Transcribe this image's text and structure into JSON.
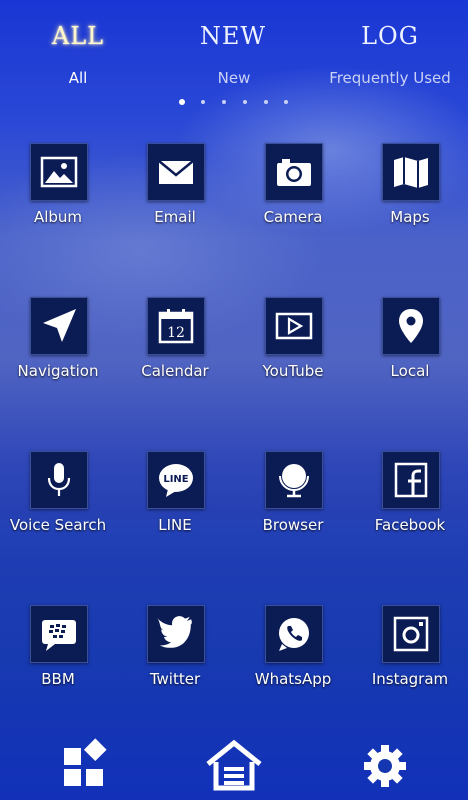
{
  "tabs": {
    "all": "ALL",
    "new": "NEW",
    "log": "LOG"
  },
  "subtabs": {
    "all": "All",
    "new": "New",
    "frequent": "Frequently Used"
  },
  "page_indicator": {
    "total": 6,
    "active": 1
  },
  "apps": [
    {
      "label": "Album",
      "icon": "picture-icon"
    },
    {
      "label": "Email",
      "icon": "envelope-icon"
    },
    {
      "label": "Camera",
      "icon": "camera-icon"
    },
    {
      "label": "Maps",
      "icon": "map-icon"
    },
    {
      "label": "Navigation",
      "icon": "navigation-arrow-icon"
    },
    {
      "label": "Calendar",
      "icon": "calendar-icon"
    },
    {
      "label": "YouTube",
      "icon": "play-icon"
    },
    {
      "label": "Local",
      "icon": "map-pin-icon"
    },
    {
      "label": "Voice Search",
      "icon": "microphone-icon"
    },
    {
      "label": "LINE",
      "icon": "line-icon"
    },
    {
      "label": "Browser",
      "icon": "globe-icon"
    },
    {
      "label": "Facebook",
      "icon": "facebook-icon"
    },
    {
      "label": "BBM",
      "icon": "bbm-icon"
    },
    {
      "label": "Twitter",
      "icon": "twitter-bird-icon"
    },
    {
      "label": "WhatsApp",
      "icon": "whatsapp-icon"
    },
    {
      "label": "Instagram",
      "icon": "instagram-icon"
    }
  ],
  "calendar_day": "12",
  "line_logo_text": "LINE",
  "dock": {
    "left": "widgets-icon",
    "center": "home-icon",
    "right": "settings-gear-icon"
  },
  "colors": {
    "accent_glow": "#fff7cc",
    "tile": "#0b1c55",
    "background": "#1a36d4"
  }
}
